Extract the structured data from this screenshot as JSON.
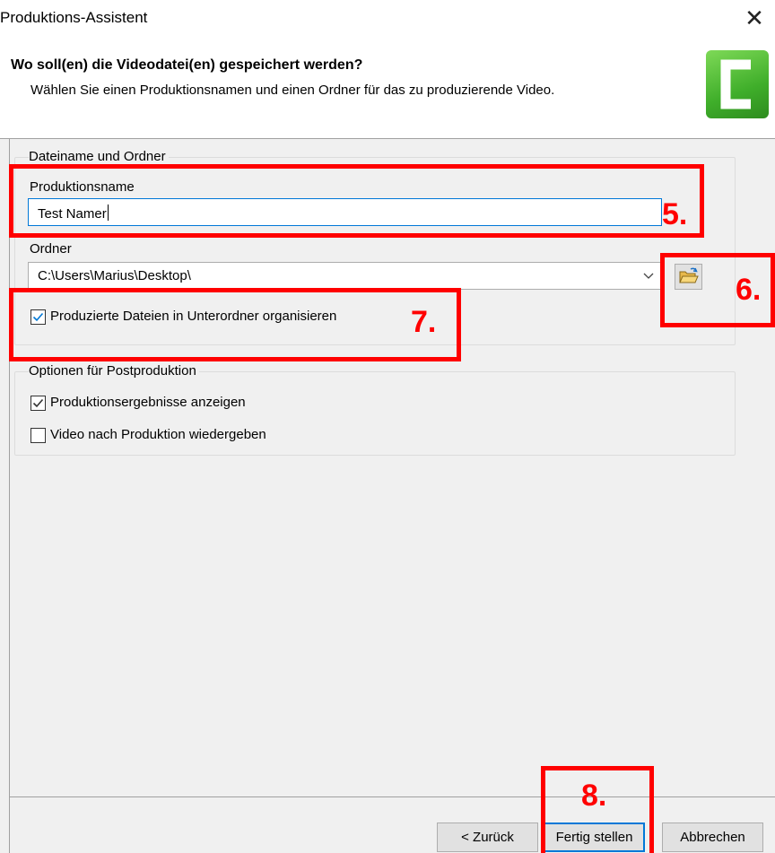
{
  "window": {
    "title": "Produktions-Assistent",
    "close_glyph": "✕"
  },
  "header": {
    "heading": "Wo soll(en) die Videodatei(en) gespeichert werden?",
    "subtext": "Wählen Sie einen Produktionsnamen und einen Ordner für das zu produzierende Video.",
    "logo_icon": "camtasia-logo-icon",
    "logo_color": "#3fae2a"
  },
  "file_group": {
    "label": "Dateiname und Ordner",
    "production_name_label": "Produktionsname",
    "production_name_value": "Test Namer",
    "folder_label": "Ordner",
    "folder_value": "C:\\Users\\Marius\\Desktop\\",
    "folder_button_icon": "open-folder-icon",
    "subfolder_checkbox": {
      "label": "Produzierte Dateien in Unterordner organisieren",
      "checked": true
    }
  },
  "post_group": {
    "label": "Optionen für Postproduktion",
    "show_results": {
      "label": "Produktionsergebnisse anzeigen",
      "checked": true
    },
    "play_video": {
      "label": "Video nach Produktion wiedergeben",
      "checked": false
    }
  },
  "buttons": {
    "back": "< Zurück",
    "finish": "Fertig stellen",
    "cancel": "Abbrechen"
  },
  "annotations": {
    "color": "#ff0000",
    "n5": "5.",
    "n6": "6.",
    "n7": "7.",
    "n8": "8."
  }
}
